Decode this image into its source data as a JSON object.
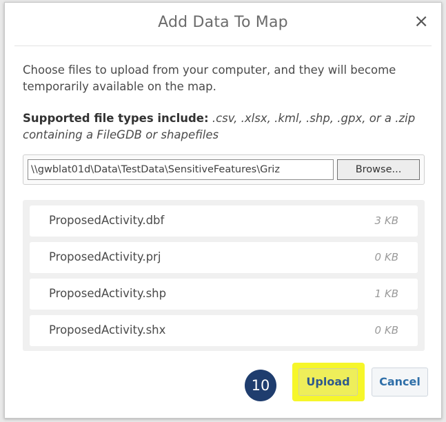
{
  "dialog": {
    "title": "Add Data To Map",
    "close_label": "×",
    "close_icon": "close-icon"
  },
  "intro": "Choose files to upload from your computer, and they will become temporarily available on the map.",
  "supported": {
    "label": "Supported file types include:",
    "types": " .csv, .xlsx, .kml, .shp, .gpx, or a .zip containing a FileGDB or shapefiles"
  },
  "file_input": {
    "value": "\\\\gwblat01d\\Data\\TestData\\SensitiveFeatures\\Griz",
    "browse_label": "Browse..."
  },
  "files": [
    {
      "name": "ProposedActivity.dbf",
      "size": "3 KB"
    },
    {
      "name": "ProposedActivity.prj",
      "size": "0 KB"
    },
    {
      "name": "ProposedActivity.shp",
      "size": "1 KB"
    },
    {
      "name": "ProposedActivity.shx",
      "size": "0 KB"
    }
  ],
  "step_badge": "10",
  "actions": {
    "upload_label": "Upload",
    "cancel_label": "Cancel"
  },
  "colors": {
    "highlight": "#f6f62a",
    "badge": "#1f3d6e",
    "link_blue": "#2f6fa8"
  }
}
